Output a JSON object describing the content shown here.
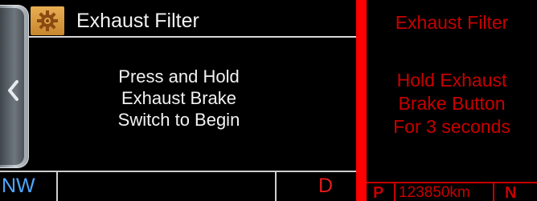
{
  "left_display": {
    "title": "Exhaust Filter",
    "title_icon": "gear-icon",
    "back_icon": "chevron-left-icon",
    "message_lines": [
      "Press and Hold",
      "Exhaust Brake",
      "Switch to Begin"
    ],
    "status": {
      "compass": "NW",
      "gear": "D"
    }
  },
  "right_display": {
    "title": "Exhaust Filter",
    "message_lines": [
      "Hold Exhaust",
      "Brake Button",
      "For 3 seconds"
    ],
    "status": {
      "gear": "P",
      "odometer": "123850km",
      "range_mode": "N"
    }
  },
  "colors": {
    "left_text": "#f2f2f2",
    "compass": "#4ea7ff",
    "gear_indicator": "#e31a1a",
    "right_text": "#c80000",
    "divider": "#ff0000",
    "icon_tile": "#d9983f"
  }
}
